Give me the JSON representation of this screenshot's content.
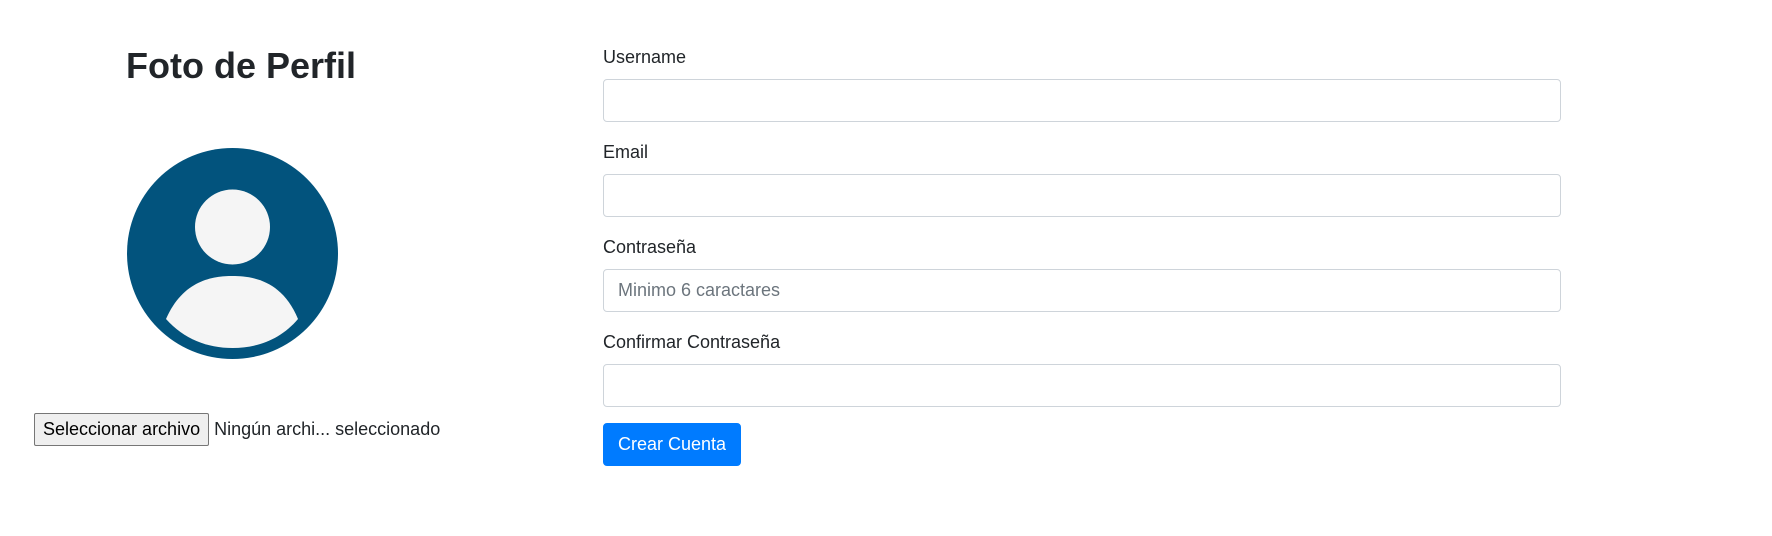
{
  "profile": {
    "title": "Foto de Perfil",
    "avatar_icon": "user-avatar-icon",
    "avatar_bg_color": "#02537d",
    "avatar_fg_color": "#f5f5f5",
    "file_button_label": "Seleccionar archivo",
    "file_status": "Ningún archi... seleccionado"
  },
  "form": {
    "username": {
      "label": "Username",
      "value": "",
      "placeholder": ""
    },
    "email": {
      "label": "Email",
      "value": "",
      "placeholder": ""
    },
    "password": {
      "label": "Contraseña",
      "value": "",
      "placeholder": "Minimo 6 caractares"
    },
    "confirm_password": {
      "label": "Confirmar Contraseña",
      "value": "",
      "placeholder": ""
    },
    "submit_label": "Crear Cuenta",
    "submit_color": "#007bff"
  }
}
